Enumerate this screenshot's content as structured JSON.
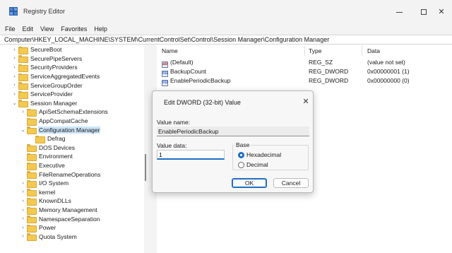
{
  "window": {
    "title": "Registry Editor"
  },
  "menu": [
    "File",
    "Edit",
    "View",
    "Favorites",
    "Help"
  ],
  "address": "Computer\\HKEY_LOCAL_MACHINE\\SYSTEM\\CurrentControlSet\\Control\\Session Manager\\Configuration Manager",
  "tree": {
    "items": [
      {
        "label": "SecureBoot",
        "expandable": true
      },
      {
        "label": "SecurePipeServers",
        "expandable": true
      },
      {
        "label": "SecurityProviders",
        "expandable": true
      },
      {
        "label": "ServiceAggregatedEvents",
        "expandable": true
      },
      {
        "label": "ServiceGroupOrder",
        "expandable": true
      },
      {
        "label": "ServiceProvider",
        "expandable": true
      },
      {
        "label": "Session Manager",
        "expandable": true,
        "expanded": true
      },
      {
        "label": "ApiSetSchemaExtensions",
        "expandable": true
      },
      {
        "label": "AppCompatCache",
        "expandable": false
      },
      {
        "label": "Configuration Manager",
        "expandable": true,
        "expanded": true,
        "selected": true
      },
      {
        "label": "Defrag",
        "expandable": false
      },
      {
        "label": "DOS Devices",
        "expandable": false
      },
      {
        "label": "Environment",
        "expandable": false
      },
      {
        "label": "Executive",
        "expandable": false
      },
      {
        "label": "FileRenameOperations",
        "expandable": false
      },
      {
        "label": "I/O System",
        "expandable": true
      },
      {
        "label": "kernel",
        "expandable": true
      },
      {
        "label": "KnownDLLs",
        "expandable": true
      },
      {
        "label": "Memory Management",
        "expandable": true
      },
      {
        "label": "NamespaceSeparation",
        "expandable": true
      },
      {
        "label": "Power",
        "expandable": true
      },
      {
        "label": "Quota System",
        "expandable": true
      }
    ]
  },
  "values": {
    "columns": {
      "name": "Name",
      "type": "Type",
      "data": "Data"
    },
    "rows": [
      {
        "name": "(Default)",
        "type": "REG_SZ",
        "data": "(value not set)",
        "icon": "string-value-icon"
      },
      {
        "name": "BackupCount",
        "type": "REG_DWORD",
        "data": "0x00000001 (1)",
        "icon": "binary-value-icon"
      },
      {
        "name": "EnablePeriodicBackup",
        "type": "REG_DWORD",
        "data": "0x00000000 (0)",
        "icon": "binary-value-icon"
      }
    ]
  },
  "dialog": {
    "title": "Edit DWORD (32-bit) Value",
    "value_name_label": "Value name:",
    "value_name": "EnablePeriodicBackup",
    "value_data_label": "Value data:",
    "value_data": "1",
    "base_label": "Base",
    "base_hex": "Hexadecimal",
    "base_dec": "Decimal",
    "base_selected": "Hexadecimal",
    "ok": "OK",
    "cancel": "Cancel"
  }
}
